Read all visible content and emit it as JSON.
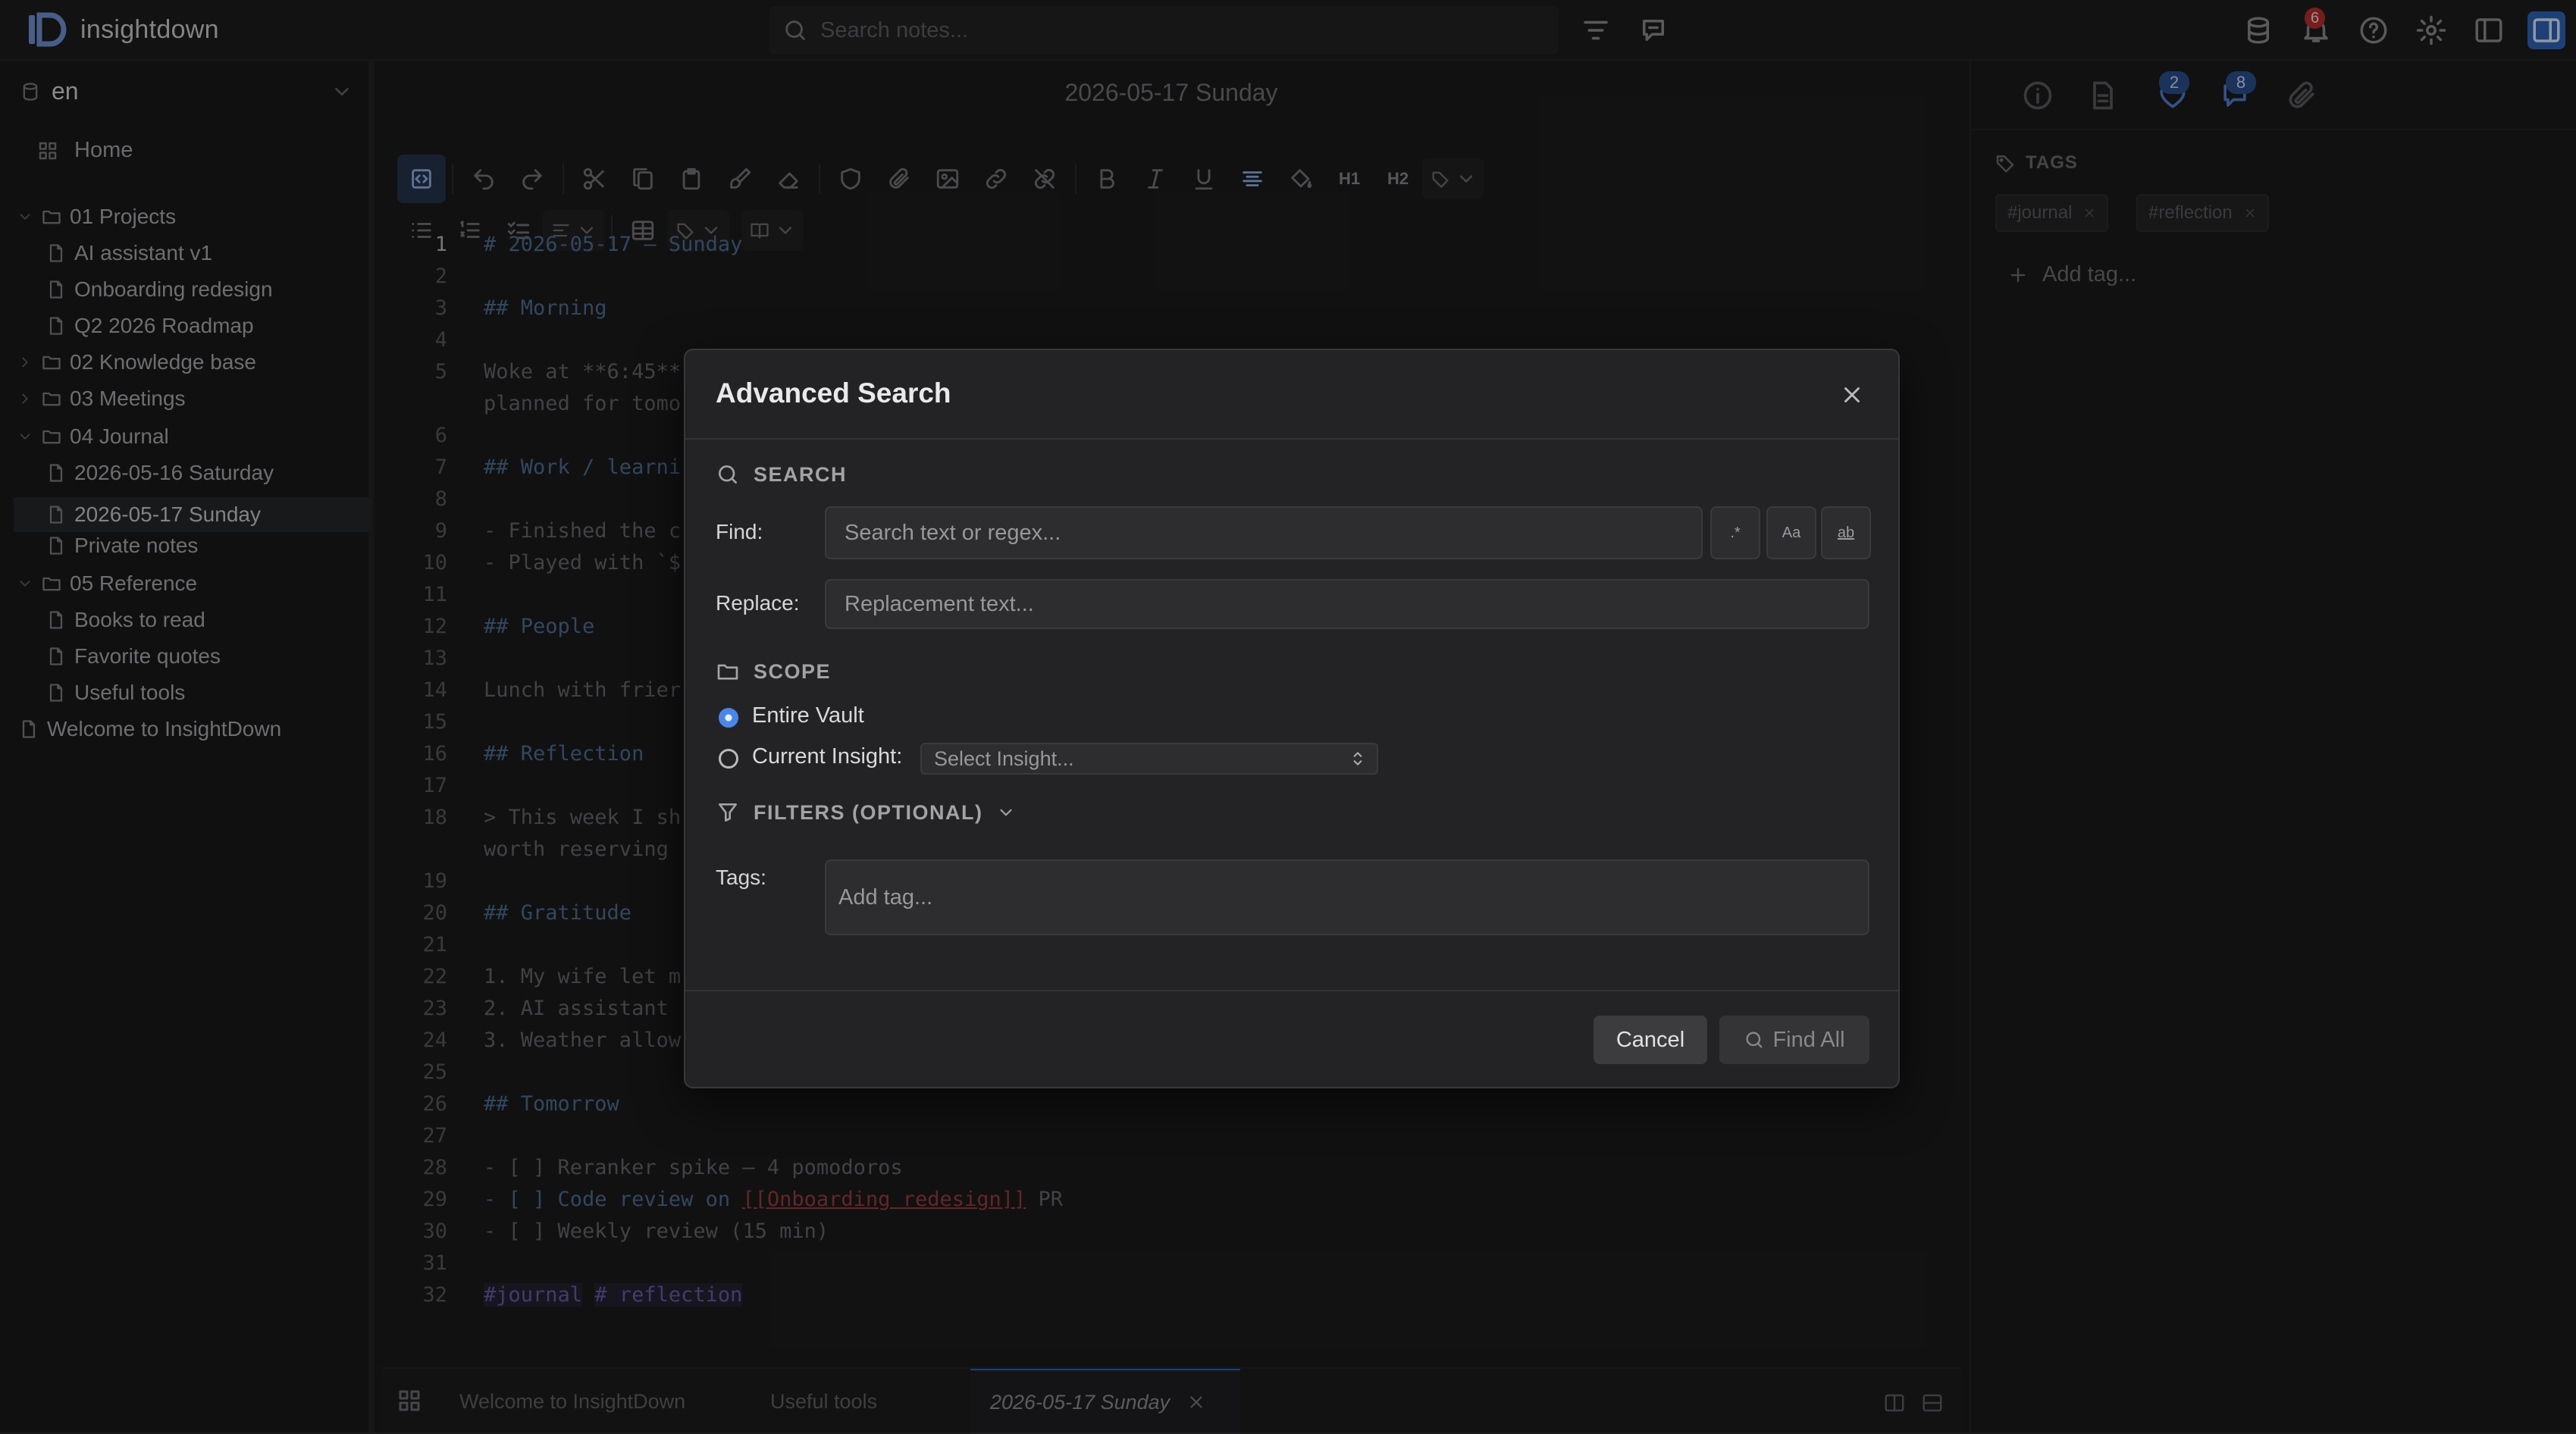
{
  "app": {
    "name": "insightdown"
  },
  "topbar": {
    "search_placeholder": "Search notes...",
    "notifications_count": "6"
  },
  "sidebar": {
    "vault_name": "en",
    "home_label": "Home",
    "items": [
      {
        "label": "01 Projects",
        "type": "folder",
        "expanded": true
      },
      {
        "label": "AI assistant v1",
        "type": "file"
      },
      {
        "label": "Onboarding redesign",
        "type": "file"
      },
      {
        "label": "Q2 2026 Roadmap",
        "type": "file"
      },
      {
        "label": "02 Knowledge base",
        "type": "folder",
        "expanded": false
      },
      {
        "label": "03 Meetings",
        "type": "folder",
        "expanded": false
      },
      {
        "label": "04 Journal",
        "type": "folder",
        "expanded": true
      },
      {
        "label": "2026-05-16 Saturday",
        "type": "file"
      },
      {
        "label": "2026-05-17 Sunday",
        "type": "file",
        "selected": true
      },
      {
        "label": "Private notes",
        "type": "file"
      },
      {
        "label": "05 Reference",
        "type": "folder",
        "expanded": true
      },
      {
        "label": "Books to read",
        "type": "file"
      },
      {
        "label": "Favorite quotes",
        "type": "file"
      },
      {
        "label": "Useful tools",
        "type": "file"
      },
      {
        "label": "Welcome to InsightDown",
        "type": "file"
      }
    ]
  },
  "editor": {
    "title": "2026-05-17 Sunday",
    "toolbar": {
      "h1": "H1",
      "h2": "H2"
    },
    "line_numbers": [
      "1",
      "2",
      "3",
      "4",
      "5",
      "",
      "6",
      "7",
      "8",
      "9",
      "10",
      "11",
      "12",
      "13",
      "14",
      "15",
      "16",
      "17",
      "18",
      "",
      "19",
      "20",
      "21",
      "22",
      "23",
      "24",
      "25",
      "26",
      "27",
      "28",
      "29",
      "30",
      "31",
      "32"
    ],
    "lines": [
      "# 2026-05-17 — Sunday",
      "",
      "## Morning",
      "",
      "Woke at **6:45**",
      "planned for tomo",
      "",
      "## Work / learni",
      "",
      "- Finished the c",
      "- Played with `$",
      "",
      "## People",
      "",
      "Lunch with frier",
      "",
      "## Reflection",
      "",
      "> This week I sh",
      "worth reserving",
      "",
      "## Gratitude",
      "",
      "1. My wife let m",
      "2. AI assistant",
      "3. Weather allow",
      "",
      "## Tomorrow",
      "",
      "- [ ] Reranker spike — 4 pomodoros",
      "- [ ] Code review on ",
      "- [ ] Weekly review (15 min)",
      "",
      "#journal # reflection"
    ],
    "link_text": "[[Onboarding redesign]]",
    "link_suffix": " PR",
    "tags_line": {
      "tag1": "#journal",
      "tag2": "# reflection"
    }
  },
  "tabs": [
    {
      "label": "Welcome to InsightDown"
    },
    {
      "label": "Useful tools"
    },
    {
      "label": "2026-05-17 Sunday",
      "active": true
    }
  ],
  "right_panel": {
    "badge_links": "2",
    "badge_backlinks": "8",
    "tags_heading": "TAGS",
    "tags": [
      "#journal",
      "#reflection"
    ],
    "add_tag": "Add tag..."
  },
  "modal": {
    "title": "Advanced Search",
    "search_section": "SEARCH",
    "find_label": "Find:",
    "find_placeholder": "Search text or regex...",
    "regex_toggle": ".*",
    "case_toggle": "Aa",
    "word_toggle": "ab",
    "replace_label": "Replace:",
    "replace_placeholder": "Replacement text...",
    "scope_section": "SCOPE",
    "scope_options": [
      {
        "label": "Entire Vault",
        "selected": true
      },
      {
        "label": "Current Insight:",
        "selected": false
      }
    ],
    "insight_select": "Select Insight...",
    "filters_section": "FILTERS (OPTIONAL)",
    "tags_label": "Tags:",
    "tags_placeholder": "Add tag...",
    "cancel": "Cancel",
    "find_all": "Find All"
  },
  "colors": {
    "accent": "#2f63b5",
    "radio_on": "#4a86e8",
    "badge_red": "#b32e2e"
  }
}
